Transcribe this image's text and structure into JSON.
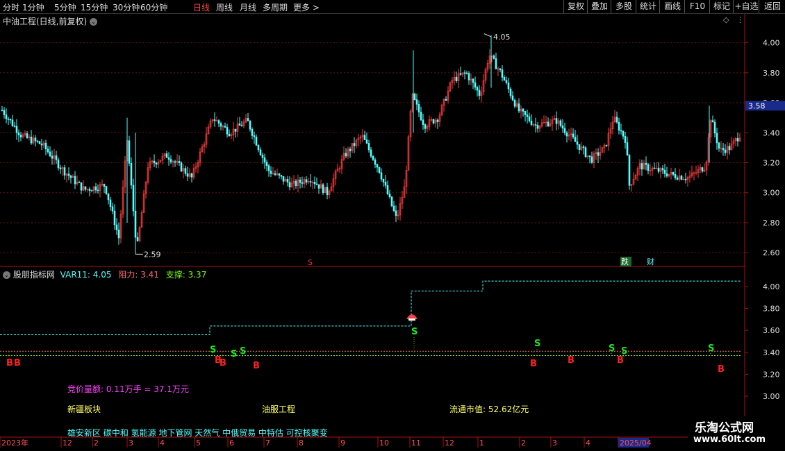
{
  "toolbar": {
    "left_items": [
      "分时",
      "1分钟",
      "5分钟",
      "15分钟",
      "30分钟",
      "60分钟",
      "日线",
      "周线",
      "月线",
      "多周期",
      "更多 >"
    ],
    "active_item": "日线",
    "right_items": [
      "复权",
      "叠加",
      "多股",
      "统计",
      "画线",
      "F10",
      "标记",
      "+自选",
      "返回"
    ]
  },
  "main_panel": {
    "title": "中油工程(日线,前复权)",
    "price_axis": [
      "4.00",
      "3.80",
      "3.60",
      "3.40",
      "3.20",
      "3.00",
      "2.80",
      "2.60"
    ],
    "current_price": "3.58",
    "high_marker": "4.05",
    "low_marker": "2.59",
    "markers": {
      "s_marker": "S",
      "die": "跌",
      "cai": "财"
    }
  },
  "indicator_panel": {
    "name": "股朋指标网",
    "var11": "VAR11: 4.05",
    "resist": "阻力: 3.41",
    "support": "支撑: 3.37",
    "axis": [
      "4.00",
      "3.80",
      "3.60",
      "3.40",
      "3.20",
      "3.00"
    ],
    "signal_s": "S",
    "signal_b": "B"
  },
  "info": {
    "bid_volume": "竞价量额: 0.11万手 = 37.1万元",
    "region": "新疆板块",
    "industry": "油服工程",
    "market_cap": "流通市值: 52.62亿元",
    "concepts": "雄安新区 碳中和 氢能源 地下管网 天然气 中俄贸易 中特估 可控核聚变"
  },
  "time_axis": {
    "labels": [
      "2023年",
      "12",
      "2",
      "3",
      "4",
      "5",
      "6",
      "7",
      "8",
      "9",
      "10",
      "11",
      "12",
      "1",
      "2",
      "3",
      "4",
      "2025/04"
    ]
  },
  "watermark": {
    "line1": "乐淘公式网",
    "line2": "www.60lt.com"
  },
  "colors": {
    "up": "#ff3b3b",
    "down": "#54ffff",
    "axis": "#b01010",
    "text_cyan": "#54ffff",
    "resist": "#ff6a6a",
    "support": "#7cfc00",
    "signal_s": "#1ee61e",
    "signal_b": "#ff2020"
  },
  "chart_data": {
    "type": "candlestick",
    "ylim": [
      2.55,
      4.1
    ],
    "high": 4.05,
    "low": 2.59,
    "last": 3.4
  }
}
